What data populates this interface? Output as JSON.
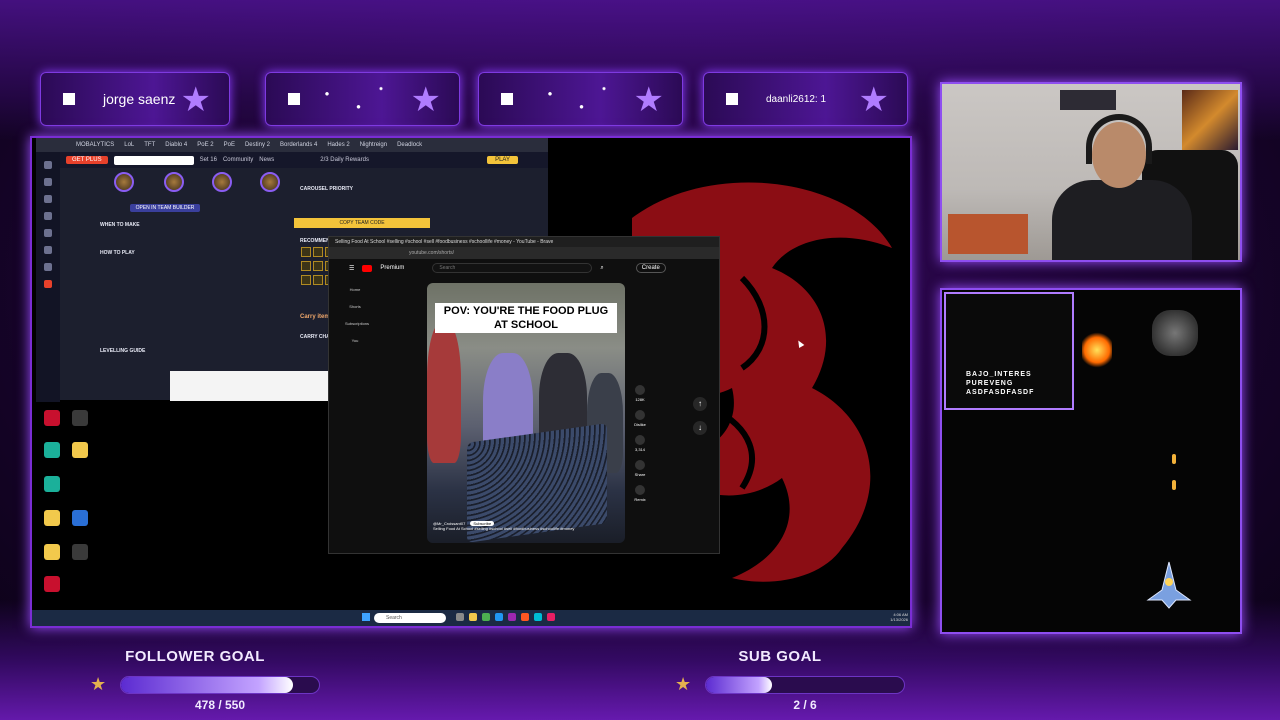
{
  "alerts": [
    {
      "name": "jorge saenz"
    },
    {
      "name": ""
    },
    {
      "name": ""
    },
    {
      "name": "daanli2612: 1"
    }
  ],
  "tft": {
    "tabs": [
      "MOBALYTICS",
      "LoL",
      "TFT",
      "Diablo 4",
      "PoE 2",
      "PoE",
      "Destiny 2",
      "Borderlands 4",
      "Hades 2",
      "Nightreign",
      "Deadlock"
    ],
    "get_plus": "GET PLUS",
    "set": "Set 16",
    "community": "Community",
    "news": "News",
    "daily_rewards": "2/3 Daily Rewards",
    "play": "PLAY",
    "open_team_builder": "OPEN IN TEAM BUILDER",
    "carousel_priority": "CAROUSEL PRIORITY",
    "copy_team_code": "COPY TEAM CODE",
    "recommended_augments": "RECOMMENDED AUGMENTS",
    "when_to_make": "WHEN TO MAKE",
    "how_to_play": "HOW TO PLAY",
    "levelling_guide": "LEVELLING GUIDE",
    "carry_items": "Carry items",
    "carry_champs": "CARRY CHAMPS"
  },
  "youtube": {
    "title": "Selling Food At School #selling #school #sell #foodbusiness #schoollife #money - YouTube - Brave",
    "url": "youtube.com/shorts/",
    "premium": "Premium",
    "search_placeholder": "Search",
    "create": "Create",
    "caption": "POV: YOU'RE THE FOOD PLUG AT SCHOOL",
    "channel": "@Mr_Croissant07",
    "subscribe": "Subscribe",
    "desc": "Selling Food At School #selling #school #sell #foodbusiness #schoollife #money",
    "likes": "128K",
    "dislike": "Dislike",
    "comments": "3,314",
    "share": "Share",
    "remix": "Remix",
    "side": [
      "Home",
      "Shorts",
      "Subscriptions",
      "You"
    ]
  },
  "taskbar": {
    "search": "Search",
    "time": "4:06 AM",
    "date": "1/13/2026"
  },
  "game": {
    "lines": [
      "BAJO_INTERES",
      "PUREVENG",
      "ASDFASDFASDF"
    ]
  },
  "goals": {
    "follower": {
      "title": "FOLLOWER GOAL",
      "count": "478 / 550",
      "progress": 0.869
    },
    "sub": {
      "title": "SUB GOAL",
      "count": "2 / 6",
      "progress": 0.333
    }
  },
  "colors": {
    "accent": "#8b3cff",
    "dragon": "#8b0d14",
    "yt_red": "#ff0000"
  }
}
